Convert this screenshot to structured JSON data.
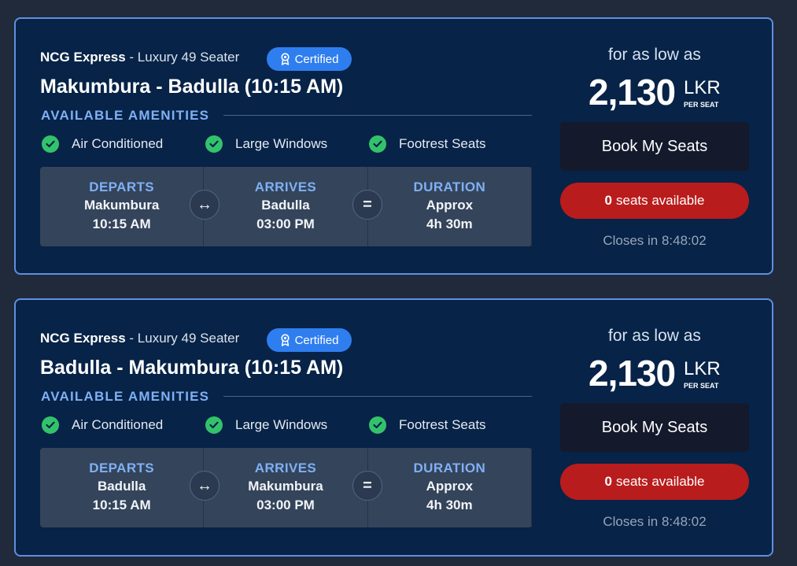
{
  "colors": {
    "background": "#202a3a",
    "card_bg": "#072347",
    "card_border": "#5f8fe0",
    "accent_blue": "#7fb0f5",
    "certified_badge": "#2f7ef0",
    "check_green": "#33c26b",
    "sold_out_red": "#b91c1c",
    "button_dark": "#141a2c"
  },
  "cards": [
    {
      "operator": "NCG Express",
      "separator": " - ",
      "bus_type": "Luxury 49 Seater",
      "badge": "Certified",
      "badge_icon": "ribbon-award-icon",
      "route_title": "Makumbura - Badulla (10:15 AM)",
      "amenities_heading": "AVAILABLE AMENITIES",
      "amenities": [
        "Air Conditioned",
        "Large Windows",
        "Footrest Seats"
      ],
      "departs": {
        "label": "DEPARTS",
        "place": "Makumbura",
        "time": "10:15 AM"
      },
      "arrives": {
        "label": "ARRIVES",
        "place": "Badulla",
        "time": "03:00 PM"
      },
      "duration": {
        "label": "DURATION",
        "line1": "Approx",
        "line2": "4h 30m"
      },
      "arrow_icon": "↔",
      "equals_icon": "=",
      "price_prefix": "for as low as",
      "price": "2,130",
      "currency": "LKR",
      "per_seat": "PER SEAT",
      "book_label": "Book My Seats",
      "seats_count": "0",
      "seats_text": "seats available",
      "closes": "Closes in 8:48:02"
    },
    {
      "operator": "NCG Express",
      "separator": " - ",
      "bus_type": "Luxury 49 Seater",
      "badge": "Certified",
      "badge_icon": "ribbon-award-icon",
      "route_title": "Badulla - Makumbura (10:15 AM)",
      "amenities_heading": "AVAILABLE AMENITIES",
      "amenities": [
        "Air Conditioned",
        "Large Windows",
        "Footrest Seats"
      ],
      "departs": {
        "label": "DEPARTS",
        "place": "Badulla",
        "time": "10:15 AM"
      },
      "arrives": {
        "label": "ARRIVES",
        "place": "Makumbura",
        "time": "03:00 PM"
      },
      "duration": {
        "label": "DURATION",
        "line1": "Approx",
        "line2": "4h 30m"
      },
      "arrow_icon": "↔",
      "equals_icon": "=",
      "price_prefix": "for as low as",
      "price": "2,130",
      "currency": "LKR",
      "per_seat": "PER SEAT",
      "book_label": "Book My Seats",
      "seats_count": "0",
      "seats_text": "seats available",
      "closes": "Closes in 8:48:02"
    }
  ]
}
